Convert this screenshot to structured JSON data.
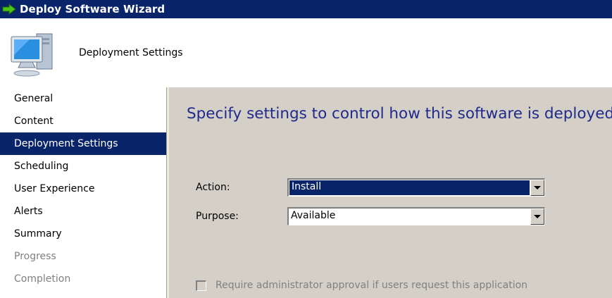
{
  "window": {
    "title": "Deploy Software Wizard",
    "title_icon": "green-arrow-icon"
  },
  "header": {
    "title": "Deployment Settings",
    "icon": "computer-icon"
  },
  "sidebar": {
    "items": [
      {
        "label": "General",
        "state": "normal"
      },
      {
        "label": "Content",
        "state": "normal"
      },
      {
        "label": "Deployment Settings",
        "state": "selected"
      },
      {
        "label": "Scheduling",
        "state": "normal"
      },
      {
        "label": "User Experience",
        "state": "normal"
      },
      {
        "label": "Alerts",
        "state": "normal"
      },
      {
        "label": "Summary",
        "state": "normal"
      },
      {
        "label": "Progress",
        "state": "disabled"
      },
      {
        "label": "Completion",
        "state": "disabled"
      }
    ]
  },
  "main": {
    "heading": "Specify settings to control how this software is deployed",
    "action": {
      "label": "Action:",
      "value": "Install"
    },
    "purpose": {
      "label": "Purpose:",
      "value": "Available"
    },
    "approval": {
      "label": "Require administrator approval if users request this application",
      "checked": false,
      "enabled": false
    }
  },
  "colors": {
    "titlebar": "#0a246a",
    "selection": "#0a246a",
    "heading": "#1f2a8c",
    "disabled_text": "#808080",
    "face": "#d4d0c8"
  }
}
